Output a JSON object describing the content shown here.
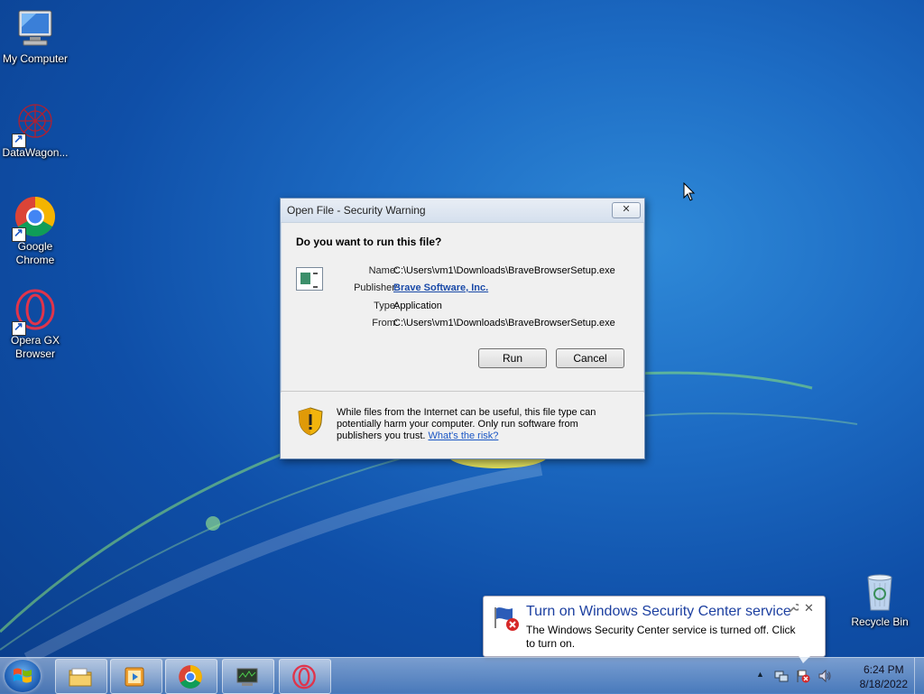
{
  "desktop": {
    "icons": [
      {
        "label": "My Computer"
      },
      {
        "label": "DataWagon..."
      },
      {
        "label_line1": "Google",
        "label_line2": "Chrome"
      },
      {
        "label_line1": "Opera GX",
        "label_line2": "Browser"
      },
      {
        "label": "Recycle Bin"
      }
    ]
  },
  "dialog": {
    "title": "Open File - Security Warning",
    "close_glyph": "✕",
    "question": "Do you want to run this file?",
    "properties": {
      "name_label": "Name:",
      "name_value": "C:\\Users\\vm1\\Downloads\\BraveBrowserSetup.exe",
      "publisher_label": "Publisher:",
      "publisher_value": "Brave Software, Inc.",
      "type_label": "Type:",
      "type_value": "Application",
      "from_label": "From:",
      "from_value": "C:\\Users\\vm1\\Downloads\\BraveBrowserSetup.exe"
    },
    "run_label": "Run",
    "cancel_label": "Cancel",
    "warning_text": "While files from the Internet can be useful, this file type can potentially harm your computer. Only run software from publishers you trust.",
    "risk_link": "What's the risk?"
  },
  "balloon": {
    "title": "Turn on Windows Security Center service",
    "text": "The Windows Security Center service is turned off. Click to turn on.",
    "close_glyph": "✕"
  },
  "taskbar": {
    "tray_arrow": "▲",
    "clock_time": "6:24 PM",
    "clock_date": "8/18/2022"
  },
  "colors": {
    "desktop_bg": "#1d6cc4",
    "dialog_bg": "#f0f0f0",
    "link": "#1a56c4",
    "balloon_title": "#1c3fa0"
  }
}
